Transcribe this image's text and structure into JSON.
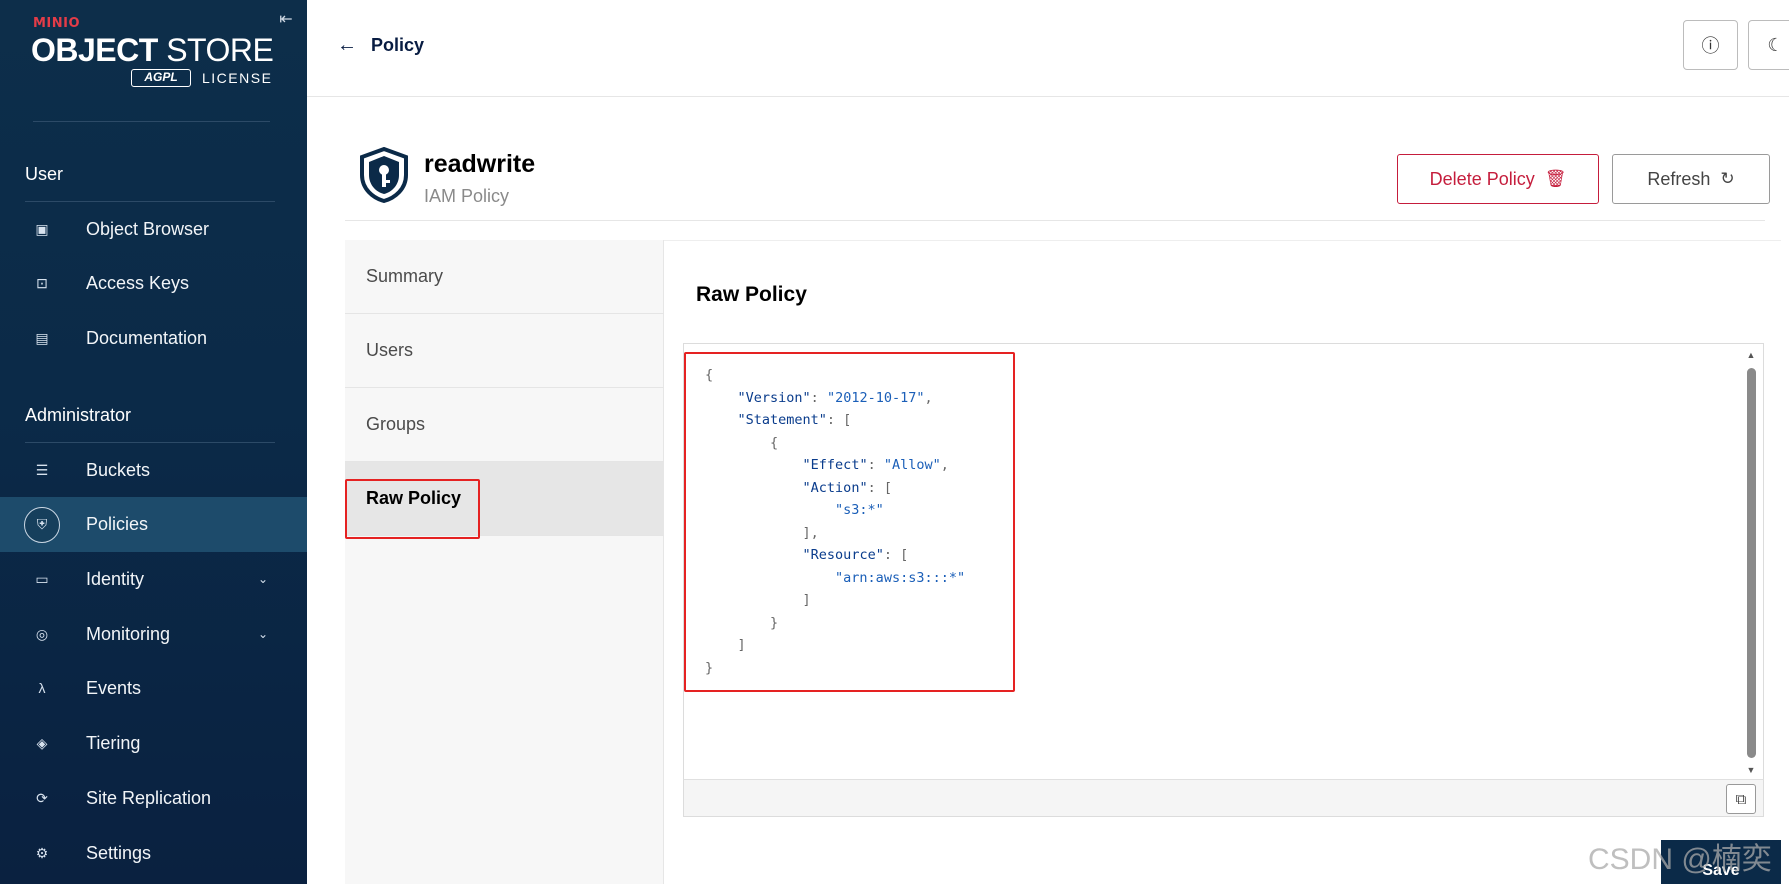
{
  "sidebar": {
    "logo": {
      "brand": "MINIO",
      "title_bold": "OBJECT",
      "title_rest": " STORE",
      "agpl": "AGPL",
      "license": "LICENSE"
    },
    "collapse_icon": "collapse-left-icon",
    "sections": [
      {
        "title": "User"
      },
      {
        "title": "Administrator"
      }
    ],
    "items": [
      {
        "label": "Object Browser",
        "icon": "object-browser-icon"
      },
      {
        "label": "Access Keys",
        "icon": "key-icon"
      },
      {
        "label": "Documentation",
        "icon": "document-icon"
      },
      {
        "label": "Buckets",
        "icon": "bucket-icon"
      },
      {
        "label": "Policies",
        "icon": "shield-icon",
        "active": true
      },
      {
        "label": "Identity",
        "icon": "identity-icon",
        "expandable": true
      },
      {
        "label": "Monitoring",
        "icon": "monitoring-icon",
        "expandable": true
      },
      {
        "label": "Events",
        "icon": "lambda-icon"
      },
      {
        "label": "Tiering",
        "icon": "layers-icon"
      },
      {
        "label": "Site Replication",
        "icon": "replication-icon"
      },
      {
        "label": "Settings",
        "icon": "gear-icon"
      }
    ]
  },
  "topbar": {
    "back_label": "Policy",
    "help_icon": "help-icon",
    "theme_icon": "moon-icon"
  },
  "policy": {
    "name": "readwrite",
    "type": "IAM Policy",
    "delete_label": "Delete Policy",
    "refresh_label": "Refresh"
  },
  "tabs": [
    {
      "label": "Summary"
    },
    {
      "label": "Users"
    },
    {
      "label": "Groups"
    },
    {
      "label": "Raw Policy",
      "active": true
    }
  ],
  "content": {
    "title": "Raw Policy",
    "policy_json": {
      "version_key": "\"Version\"",
      "version_value": "\"2012-10-17\"",
      "statement_key": "\"Statement\"",
      "effect_key": "\"Effect\"",
      "effect_value": "\"Allow\"",
      "action_key": "\"Action\"",
      "action_value": "\"s3:*\"",
      "resource_key": "\"Resource\"",
      "resource_value": "\"arn:aws:s3:::*\""
    },
    "save_label": "Save"
  },
  "watermark": "CSDN @楠奕",
  "colors": {
    "sidebar_bg": "#0b2a48",
    "active_item": "#1d4b6b",
    "danger": "#c51d3c",
    "highlight": "#e52222",
    "code_key": "#0a3c8c"
  }
}
